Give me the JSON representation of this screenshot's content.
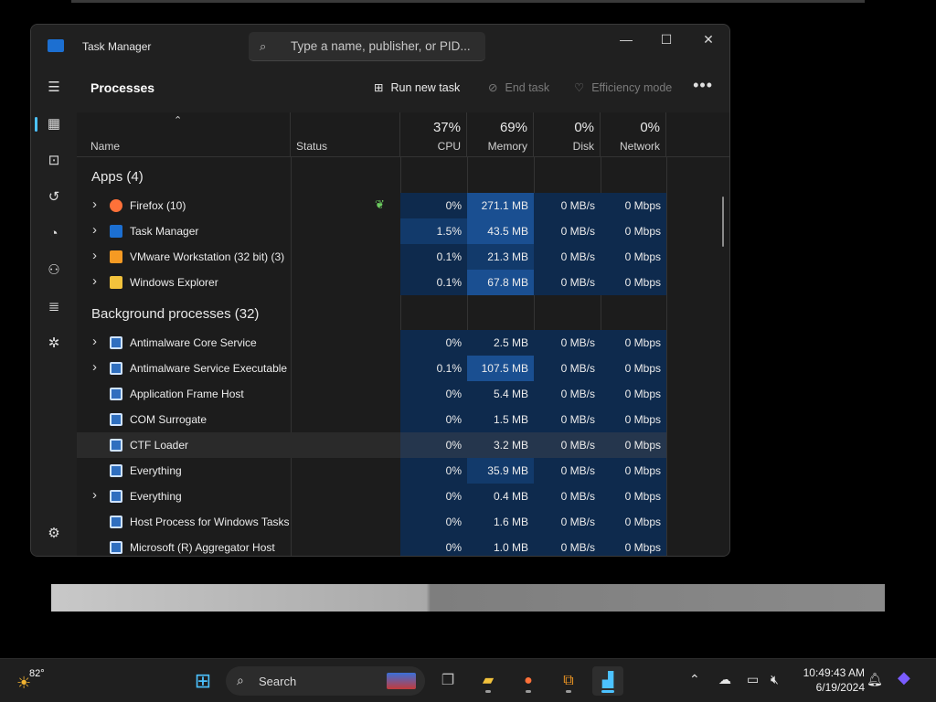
{
  "window": {
    "title": "Task Manager",
    "search_placeholder": "Type a name, publisher, or PID...",
    "controls": {
      "minimize": "—",
      "maximize": "☐",
      "close": "✕"
    }
  },
  "toolbar": {
    "page_title": "Processes",
    "run_new_task": "Run new task",
    "end_task": "End task",
    "efficiency_mode": "Efficiency mode",
    "more": "•••"
  },
  "columns": {
    "name": "Name",
    "status": "Status",
    "cpu": {
      "pct": "37%",
      "label": "CPU"
    },
    "memory": {
      "pct": "69%",
      "label": "Memory"
    },
    "disk": {
      "pct": "0%",
      "label": "Disk"
    },
    "network": {
      "pct": "0%",
      "label": "Network"
    }
  },
  "groups": {
    "apps": "Apps (4)",
    "background": "Background processes (32)"
  },
  "apps": [
    {
      "name": "Firefox (10)",
      "cpu": "0%",
      "memory": "271.1 MB",
      "disk": "0 MB/s",
      "network": "0 Mbps",
      "expandable": true,
      "icon": "firefox-icon",
      "status_icon": "efficiency-leaf-icon"
    },
    {
      "name": "Task Manager",
      "cpu": "1.5%",
      "memory": "43.5 MB",
      "disk": "0 MB/s",
      "network": "0 Mbps",
      "expandable": true,
      "icon": "task-manager-icon"
    },
    {
      "name": "VMware Workstation (32 bit) (3)",
      "cpu": "0.1%",
      "memory": "21.3 MB",
      "disk": "0 MB/s",
      "network": "0 Mbps",
      "expandable": true,
      "icon": "vmware-icon"
    },
    {
      "name": "Windows Explorer",
      "cpu": "0.1%",
      "memory": "67.8 MB",
      "disk": "0 MB/s",
      "network": "0 Mbps",
      "expandable": true,
      "icon": "folder-icon"
    }
  ],
  "background": [
    {
      "name": "Antimalware Core Service",
      "cpu": "0%",
      "memory": "2.5 MB",
      "disk": "0 MB/s",
      "network": "0 Mbps",
      "expandable": true
    },
    {
      "name": "Antimalware Service Executable",
      "cpu": "0.1%",
      "memory": "107.5 MB",
      "disk": "0 MB/s",
      "network": "0 Mbps",
      "expandable": true
    },
    {
      "name": "Application Frame Host",
      "cpu": "0%",
      "memory": "5.4 MB",
      "disk": "0 MB/s",
      "network": "0 Mbps",
      "expandable": false
    },
    {
      "name": "COM Surrogate",
      "cpu": "0%",
      "memory": "1.5 MB",
      "disk": "0 MB/s",
      "network": "0 Mbps",
      "expandable": false
    },
    {
      "name": "CTF Loader",
      "cpu": "0%",
      "memory": "3.2 MB",
      "disk": "0 MB/s",
      "network": "0 Mbps",
      "expandable": false
    },
    {
      "name": "Everything",
      "cpu": "0%",
      "memory": "35.9 MB",
      "disk": "0 MB/s",
      "network": "0 Mbps",
      "expandable": false
    },
    {
      "name": "Everything",
      "cpu": "0%",
      "memory": "0.4 MB",
      "disk": "0 MB/s",
      "network": "0 Mbps",
      "expandable": true
    },
    {
      "name": "Host Process for Windows Tasks",
      "cpu": "0%",
      "memory": "1.6 MB",
      "disk": "0 MB/s",
      "network": "0 Mbps",
      "expandable": false
    },
    {
      "name": "Microsoft (R) Aggregator Host",
      "cpu": "0%",
      "memory": "1.0 MB",
      "disk": "0 MB/s",
      "network": "0 Mbps",
      "expandable": false
    }
  ],
  "taskbar": {
    "weather_temp": "82°",
    "search_label": "Search",
    "time": "10:49:43 AM",
    "date": "6/19/2024"
  },
  "colors": {
    "accent": "#4cc2ff",
    "heat_low": "#0e2a4d",
    "heat_mid": "#123a6b",
    "heat_high": "#1a4f91"
  }
}
